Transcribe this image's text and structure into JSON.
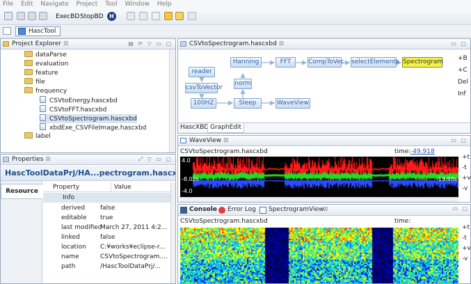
{
  "menubar": [
    "File",
    "Edit",
    "Navigate",
    "Project",
    "Tool",
    "Window",
    "Help"
  ],
  "toolbar": {
    "execbd": "ExecBD",
    "stopbd": "StopBD",
    "h_button": "H"
  },
  "perspective": {
    "tab": "HascTool"
  },
  "project_explorer": {
    "title": "Project Explorer",
    "items": [
      {
        "label": "dataParse",
        "kind": "folder",
        "indent": 1
      },
      {
        "label": "evaluation",
        "kind": "folder",
        "indent": 1
      },
      {
        "label": "feature",
        "kind": "folder",
        "indent": 1
      },
      {
        "label": "file",
        "kind": "folder",
        "indent": 1
      },
      {
        "label": "frequency",
        "kind": "folder",
        "indent": 1
      },
      {
        "label": "CSVtoEnergy.hascxbd",
        "kind": "file",
        "indent": 2
      },
      {
        "label": "CSVtoFFT.hascxbd",
        "kind": "file",
        "indent": 2
      },
      {
        "label": "CSVtoSpectrogram.hascxbd",
        "kind": "file",
        "indent": 2
      },
      {
        "label": "xbdExe_CSVFileImage.hascxbd",
        "kind": "file",
        "indent": 2
      },
      {
        "label": "label",
        "kind": "folder",
        "indent": 1
      }
    ]
  },
  "properties": {
    "title": "Properties",
    "header": "HascToolDataPrj/HA...pectrogram.hascxbd",
    "resource_tab": "Resource",
    "col_property": "Property",
    "col_value": "Value",
    "group": "Info",
    "rows": [
      {
        "k": "derived",
        "v": "false"
      },
      {
        "k": "editable",
        "v": "true"
      },
      {
        "k": "last modified",
        "v": "March 27, 2011 4:2..."
      },
      {
        "k": "linked",
        "v": "false"
      },
      {
        "k": "location",
        "v": "C:¥works¥eclipse-r..."
      },
      {
        "k": "name",
        "v": "CSVtoSpectrogram...."
      },
      {
        "k": "path",
        "v": "/HascToolDataPrj/..."
      }
    ]
  },
  "editor": {
    "tab": "CSVtoSpectrogram.hascxbd",
    "nodes": {
      "reader": "reader",
      "hanning": "Hanning",
      "fft": "FFT",
      "comptovec": "CompToVec",
      "selectelements": "selectElements",
      "spectrogram": "Spectrogram",
      "csvtovector": "csvToVector",
      "norm": "norm",
      "hz100": "100HZ",
      "sleep": "Sleep",
      "waveview": "WaveView"
    },
    "bottom_tabs": [
      "HascXBD",
      "GraphEdit"
    ],
    "right_partial": [
      "+B",
      "+C",
      "Del",
      "Inf"
    ]
  },
  "waveview": {
    "title": "WaveView",
    "file": "CSVtoSpectrogram.hascxbd",
    "time_label": "time:",
    "time_value": "-49.918",
    "y_top": "4.0",
    "y_bottom": "-4.0",
    "x_left": "-8.02s",
    "x_right": "19.98s",
    "right_partial": [
      "+t",
      "-t",
      "+v",
      "-v"
    ]
  },
  "console_panel": {
    "tabs": [
      "Console",
      "Error Log",
      "SpectrogramView"
    ],
    "file": "CSVtoSpectrogram.hascxbd",
    "time_label": "time:",
    "right_partial": [
      "+t",
      "-t",
      "+v",
      "-v"
    ]
  },
  "colors": {
    "accent": "#1f4f8a",
    "selection": "#f3f34a",
    "node_text": "#2e5fa0"
  }
}
